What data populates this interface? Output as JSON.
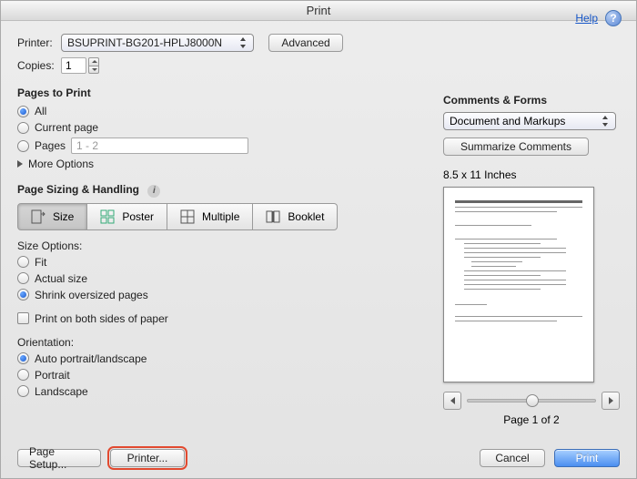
{
  "window": {
    "title": "Print"
  },
  "help": {
    "label": "Help"
  },
  "printer": {
    "label": "Printer:",
    "value": "BSUPRINT-BG201-HPLJ8000N"
  },
  "advanced_btn": "Advanced",
  "copies": {
    "label": "Copies:",
    "value": "1"
  },
  "pages_to_print": {
    "title": "Pages to Print",
    "all": "All",
    "current": "Current page",
    "range_label": "Pages",
    "range_value": "1 - 2",
    "more": "More Options"
  },
  "sizing": {
    "title": "Page Sizing & Handling",
    "segments": {
      "size": "Size",
      "poster": "Poster",
      "multiple": "Multiple",
      "booklet": "Booklet"
    },
    "options_label": "Size Options:",
    "fit": "Fit",
    "actual": "Actual size",
    "shrink": "Shrink oversized pages",
    "duplex": "Print on both sides of paper"
  },
  "orientation": {
    "title": "Orientation:",
    "auto": "Auto portrait/landscape",
    "portrait": "Portrait",
    "landscape": "Landscape"
  },
  "comments": {
    "title": "Comments & Forms",
    "select_value": "Document and Markups",
    "summarize": "Summarize Comments"
  },
  "preview": {
    "dimensions": "8.5 x 11 Inches",
    "page_indicator": "Page 1 of 2"
  },
  "footer": {
    "page_setup": "Page Setup...",
    "printer": "Printer...",
    "cancel": "Cancel",
    "print": "Print"
  }
}
